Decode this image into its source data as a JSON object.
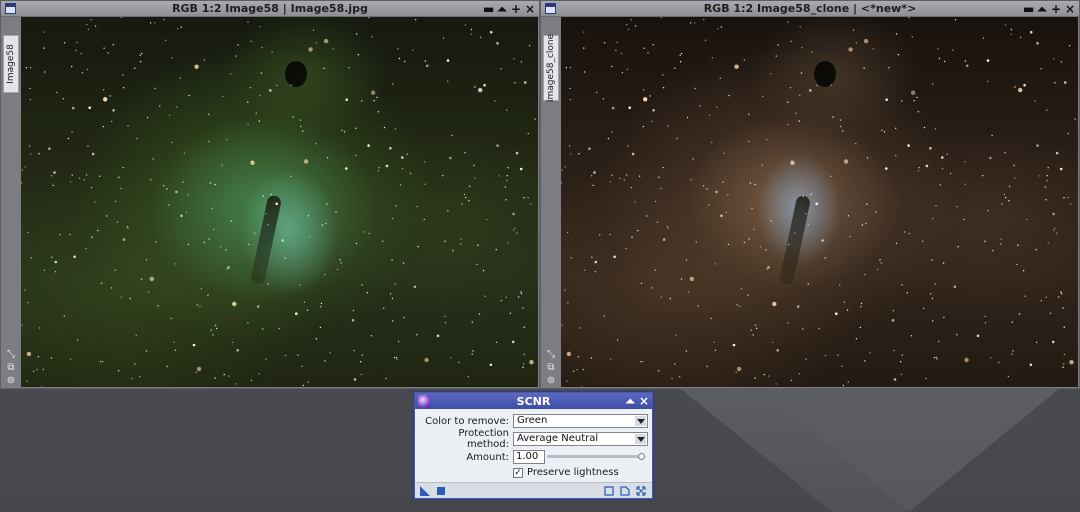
{
  "left_window": {
    "title": "RGB 1:2 Image58 | Image58.jpg",
    "side_tab": "Image58"
  },
  "right_window": {
    "title": "RGB 1:2 Image58_clone | <*new*>",
    "side_tab": "Image58_clone"
  },
  "window_controls": [
    "▬",
    "⏶",
    "+",
    "×"
  ],
  "side_icons": [
    "⤡",
    "⧉",
    "⊚"
  ],
  "dialog": {
    "title": "SCNR",
    "controls": [
      "⏶",
      "×"
    ],
    "color_label": "Color to remove:",
    "color_value": "Green",
    "protection_label": "Protection method:",
    "protection_value": "Average Neutral",
    "amount_label": "Amount:",
    "amount_value": "1.00",
    "amount_fraction": 1.0,
    "preserve_label": "Preserve lightness",
    "preserve_checked": "✓"
  },
  "colors": {
    "dialog_title": "#4656b0",
    "window_title": "#9c9ea3"
  },
  "icons": {
    "footer": [
      "new-instance-icon",
      "apply-global-icon",
      "preview-icon",
      "reset-icon",
      "expand-icon"
    ]
  }
}
